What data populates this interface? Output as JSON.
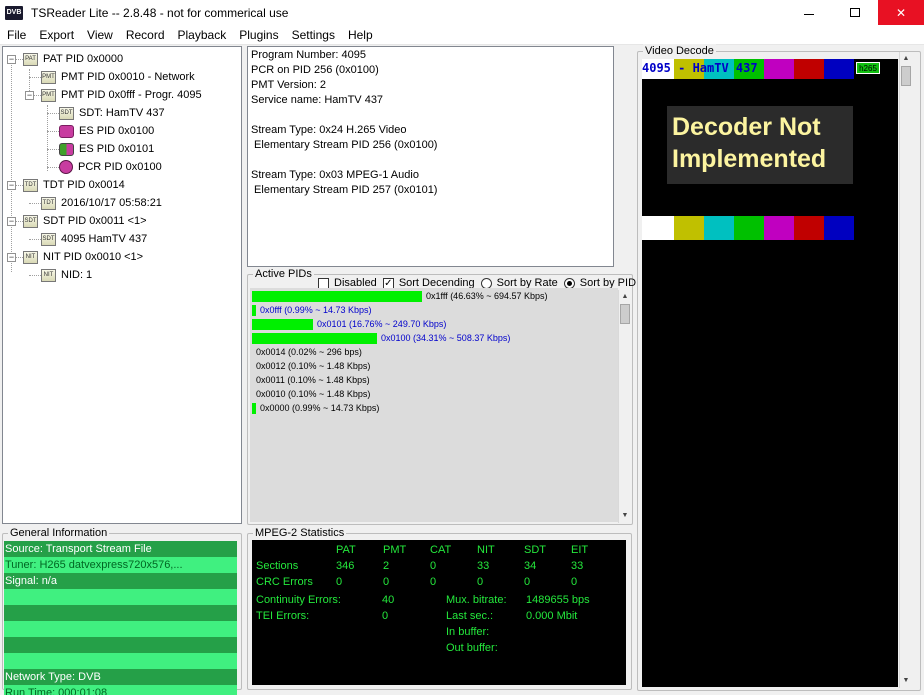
{
  "window": {
    "title": "TSReader Lite -- 2.8.48 - not for commerical use",
    "app_icon_text": "DVB"
  },
  "menu": [
    "File",
    "Export",
    "View",
    "Record",
    "Playback",
    "Plugins",
    "Settings",
    "Help"
  ],
  "tree": [
    {
      "label": "PAT PID 0x0000",
      "icon": "PAT",
      "expander": "−"
    },
    {
      "label": "PMT PID 0x0010 - Network",
      "icon": "PMT"
    },
    {
      "label": "PMT PID 0x0fff - Progr. 4095",
      "icon": "PMT",
      "expander": "−"
    },
    {
      "label": "SDT: HamTV 437",
      "icon": "SDT"
    },
    {
      "label": "ES PID 0x0100",
      "icon": "ES"
    },
    {
      "label": "ES PID 0x0101",
      "icon": "ES"
    },
    {
      "label": "PCR PID 0x0100",
      "icon": "PCR"
    },
    {
      "label": "TDT PID 0x0014",
      "icon": "TDT",
      "expander": "−"
    },
    {
      "label": "2016/10/17 05:58:21",
      "icon": "TDT"
    },
    {
      "label": "SDT PID 0x0011 <1>",
      "icon": "SDT",
      "expander": "−"
    },
    {
      "label": "4095 HamTV 437",
      "icon": "SDT"
    },
    {
      "label": "NIT PID 0x0010 <1>",
      "icon": "NIT",
      "expander": "−"
    },
    {
      "label": "NID: 1",
      "icon": "NIT"
    }
  ],
  "info_lines": [
    "Program Number: 4095",
    "PCR on PID 256 (0x0100)",
    "PMT Version: 2",
    "Service name: HamTV 437",
    "",
    "Stream Type: 0x24 H.265 Video",
    " Elementary Stream PID 256 (0x0100)",
    "",
    "Stream Type: 0x03 MPEG-1 Audio",
    " Elementary Stream PID 257 (0x0101)"
  ],
  "active_pids": {
    "label": "Active PIDs",
    "controls": {
      "disabled": {
        "label": "Disabled",
        "checked": false
      },
      "sort_desc": {
        "label": "Sort Decending",
        "checked": true
      },
      "sort_rate": {
        "label": "Sort by Rate",
        "selected": false
      },
      "sort_pid": {
        "label": "Sort by PID",
        "selected": true
      }
    },
    "rows": [
      {
        "text": "0x1fff (46.63% ~ 694.57 Kbps)",
        "percent": 46.63,
        "blue": false
      },
      {
        "text": "0x0fff (0.99% ~ 14.73 Kbps)",
        "percent": 0.99,
        "blue": true
      },
      {
        "text": "0x0101 (16.76% ~ 249.70 Kbps)",
        "percent": 16.76,
        "blue": true
      },
      {
        "text": "0x0100 (34.31% ~ 508.37 Kbps)",
        "percent": 34.31,
        "blue": true
      },
      {
        "text": "0x0014 (0.02% ~ 296 bps)",
        "percent": 0.02,
        "blue": false
      },
      {
        "text": "0x0012 (0.10% ~ 1.48 Kbps)",
        "percent": 0.1,
        "blue": false
      },
      {
        "text": "0x0011 (0.10% ~ 1.48 Kbps)",
        "percent": 0.1,
        "blue": false
      },
      {
        "text": "0x0010 (0.10% ~ 1.48 Kbps)",
        "percent": 0.1,
        "blue": false
      },
      {
        "text": "0x0000 (0.99% ~ 14.73 Kbps)",
        "percent": 0.99,
        "blue": false
      }
    ]
  },
  "general_info": {
    "label": "General Information",
    "rows": [
      "Source: Transport Stream File",
      "Tuner: H265 datvexpress720x576,...",
      "Signal: n/a",
      "",
      "",
      "",
      "",
      "",
      "Network Type: DVB",
      "Run Time: 000:01:08"
    ]
  },
  "mpeg_stats": {
    "label": "MPEG-2 Statistics",
    "columns": [
      "PAT",
      "PMT",
      "CAT",
      "NIT",
      "SDT",
      "EIT"
    ],
    "sections_label": "Sections",
    "sections": [
      "346",
      "2",
      "0",
      "33",
      "34",
      "33"
    ],
    "crc_label": "CRC Errors",
    "crc": [
      "0",
      "0",
      "0",
      "0",
      "0",
      "0"
    ],
    "continuity_label": "Continuity Errors:",
    "continuity": "40",
    "tei_label": "TEI Errors:",
    "tei": "0",
    "mux_label": "Mux. bitrate:",
    "mux": "1489655 bps",
    "last_label": "Last sec.:",
    "last": "0.000 Mbit",
    "inbuf_label": "In buffer:",
    "outbuf_label": "Out buffer:"
  },
  "video": {
    "label": "Video Decode",
    "stream_label": "4095 - HamTV 437",
    "codec_badge": "h265",
    "decoder_message": "Decoder Not Implemented",
    "color_bars": [
      "#ffffff",
      "#c0c000",
      "#00c0c0",
      "#00c000",
      "#c000c0",
      "#c00000",
      "#0000c0"
    ]
  }
}
